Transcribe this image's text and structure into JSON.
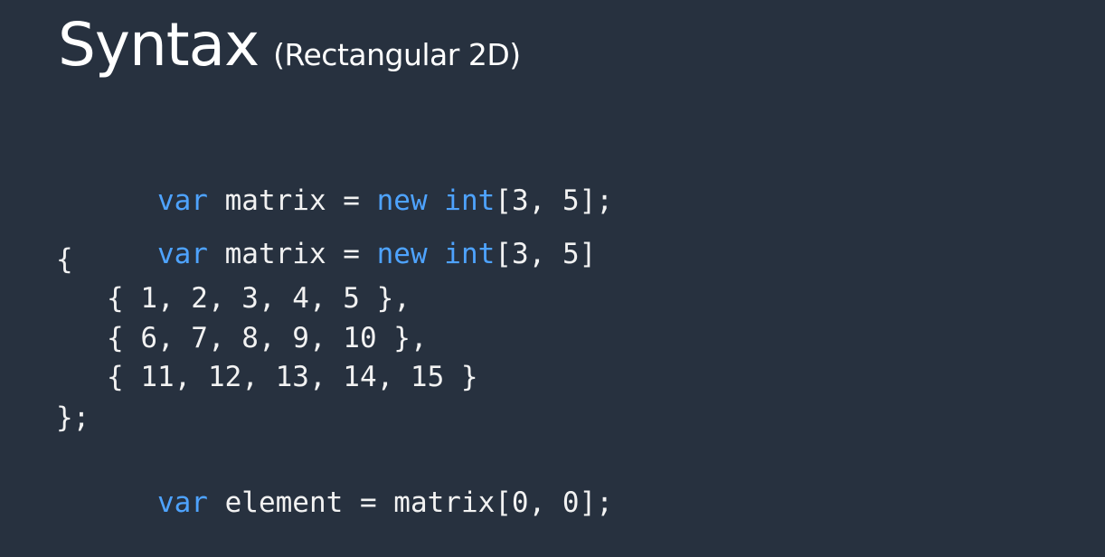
{
  "colors": {
    "background": "#27313f",
    "text": "#f2f2f2",
    "keyword": "#4ea3ff"
  },
  "title": {
    "main": "Syntax",
    "sub": "(Rectangular 2D)"
  },
  "code": {
    "line1": [
      {
        "text": "var",
        "kind": "keyword"
      },
      {
        "text": " matrix = ",
        "kind": "plain"
      },
      {
        "text": "new",
        "kind": "keyword"
      },
      {
        "text": " ",
        "kind": "plain"
      },
      {
        "text": "int",
        "kind": "keyword"
      },
      {
        "text": "[3, 5];",
        "kind": "plain"
      }
    ],
    "line2": [
      {
        "text": "var",
        "kind": "keyword"
      },
      {
        "text": " matrix = ",
        "kind": "plain"
      },
      {
        "text": "new",
        "kind": "keyword"
      },
      {
        "text": " ",
        "kind": "plain"
      },
      {
        "text": "int",
        "kind": "keyword"
      },
      {
        "text": "[3, 5]",
        "kind": "plain"
      }
    ],
    "line3": "{",
    "line4": "   { 1, 2, 3, 4, 5 },",
    "line5": "   { 6, 7, 8, 9, 10 },",
    "line6": "   { 11, 12, 13, 14, 15 }",
    "line7": "};",
    "line8": [
      {
        "text": "var",
        "kind": "keyword"
      },
      {
        "text": " element = matrix[0, 0];",
        "kind": "plain"
      }
    ]
  }
}
